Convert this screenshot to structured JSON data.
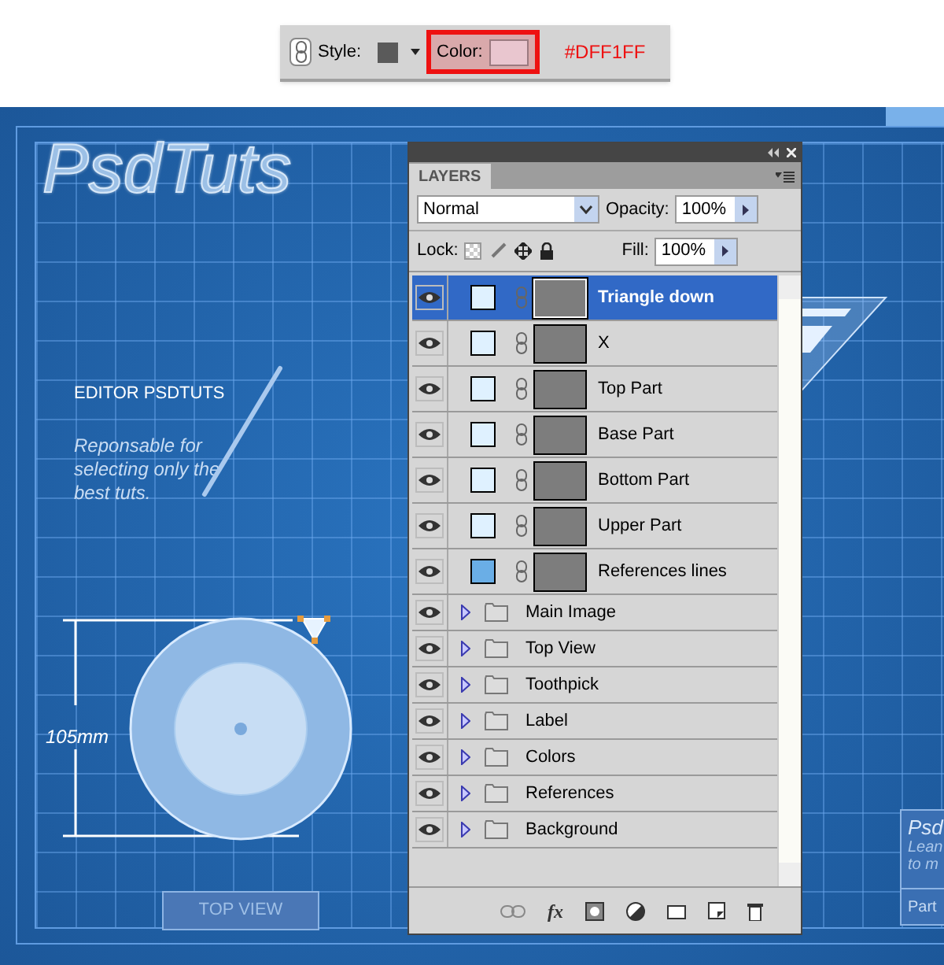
{
  "options_bar": {
    "style_label": "Style:",
    "color_label": "Color:",
    "note": "#DFF1FF"
  },
  "canvas": {
    "logo": "PsdTuts",
    "editor_title": "EDITOR PSDTUTS",
    "editor_text": "Reponsable for selecting only the best tuts.",
    "dimension": "105mm",
    "view_label": "TOP VIEW",
    "side_card": {
      "title": "Psd",
      "lines": [
        "Lean",
        "to m"
      ],
      "footer": "Part"
    }
  },
  "layers_panel": {
    "tab": "LAYERS",
    "blend_mode": "Normal",
    "opacity_label": "Opacity:",
    "opacity": "100%",
    "lock_label": "Lock:",
    "fill_label": "Fill:",
    "fill": "100%",
    "fx_label": "fx",
    "layers": [
      {
        "kind": "shape",
        "name": "Triangle down",
        "selected": true,
        "visible": true,
        "color": "#dff1ff"
      },
      {
        "kind": "shape",
        "name": "X",
        "selected": false,
        "visible": true,
        "color": "#dff1ff"
      },
      {
        "kind": "shape",
        "name": "Top Part",
        "selected": false,
        "visible": true,
        "color": "#dff1ff"
      },
      {
        "kind": "shape",
        "name": "Base Part",
        "selected": false,
        "visible": true,
        "color": "#dff1ff"
      },
      {
        "kind": "shape",
        "name": "Bottom Part",
        "selected": false,
        "visible": true,
        "color": "#dff1ff"
      },
      {
        "kind": "shape",
        "name": "Upper Part",
        "selected": false,
        "visible": true,
        "color": "#dff1ff"
      },
      {
        "kind": "shape",
        "name": "References lines",
        "selected": false,
        "visible": true,
        "color": "#6aaee6"
      },
      {
        "kind": "group",
        "name": "Main Image",
        "selected": false,
        "visible": true
      },
      {
        "kind": "group",
        "name": "Top View",
        "selected": false,
        "visible": true
      },
      {
        "kind": "group",
        "name": "Toothpick",
        "selected": false,
        "visible": true
      },
      {
        "kind": "group",
        "name": "Label",
        "selected": false,
        "visible": true
      },
      {
        "kind": "group",
        "name": "Colors",
        "selected": false,
        "visible": true
      },
      {
        "kind": "group",
        "name": "References",
        "selected": false,
        "visible": true
      },
      {
        "kind": "group",
        "name": "Background",
        "selected": false,
        "visible": true
      }
    ]
  }
}
